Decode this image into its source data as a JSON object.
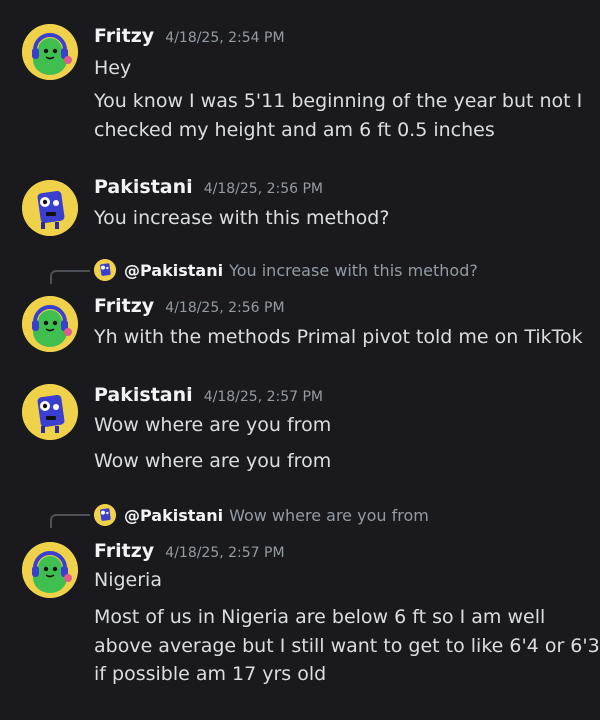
{
  "messages": [
    {
      "author": "Fritzy",
      "timestamp": "4/18/25, 2:54 PM",
      "lines": [
        "Hey",
        "You know I was 5'11 beginning of the year but not I",
        "checked my height and am 6 ft 0.5 inches"
      ],
      "avatar_icon": "green-headphones-avatar"
    },
    {
      "author": "Pakistani",
      "timestamp": "4/18/25, 2:56 PM",
      "lines": [
        "You increase with this method?"
      ],
      "avatar_icon": "blue-robot-avatar"
    },
    {
      "reply": {
        "author": "@Pakistani",
        "text": "You increase with this method?"
      },
      "author": "Fritzy",
      "timestamp": "4/18/25, 2:56 PM",
      "lines": [
        "Yh with the methods Primal pivot told me on TikTok"
      ],
      "avatar_icon": "green-headphones-avatar"
    },
    {
      "author": "Pakistani",
      "timestamp": "4/18/25, 2:57 PM",
      "lines": [
        "Wow where are you from",
        "Wow where are you from"
      ],
      "avatar_icon": "blue-robot-avatar"
    },
    {
      "reply": {
        "author": "@Pakistani",
        "text": "Wow where are you from"
      },
      "author": "Fritzy",
      "timestamp": "4/18/25, 2:57 PM",
      "lines": [
        "Nigeria",
        "Most of us in Nigeria are below 6 ft so I am well",
        "above average but I still want to get to like 6'4 or 6'3",
        "if possible am 17 yrs old"
      ],
      "avatar_icon": "green-headphones-avatar"
    }
  ],
  "colors": {
    "background": "#1a1a1e",
    "author": "#f2f3f5",
    "text": "#dbdee1",
    "muted": "#949ba4",
    "avatar_bg": "#f0d14a"
  }
}
